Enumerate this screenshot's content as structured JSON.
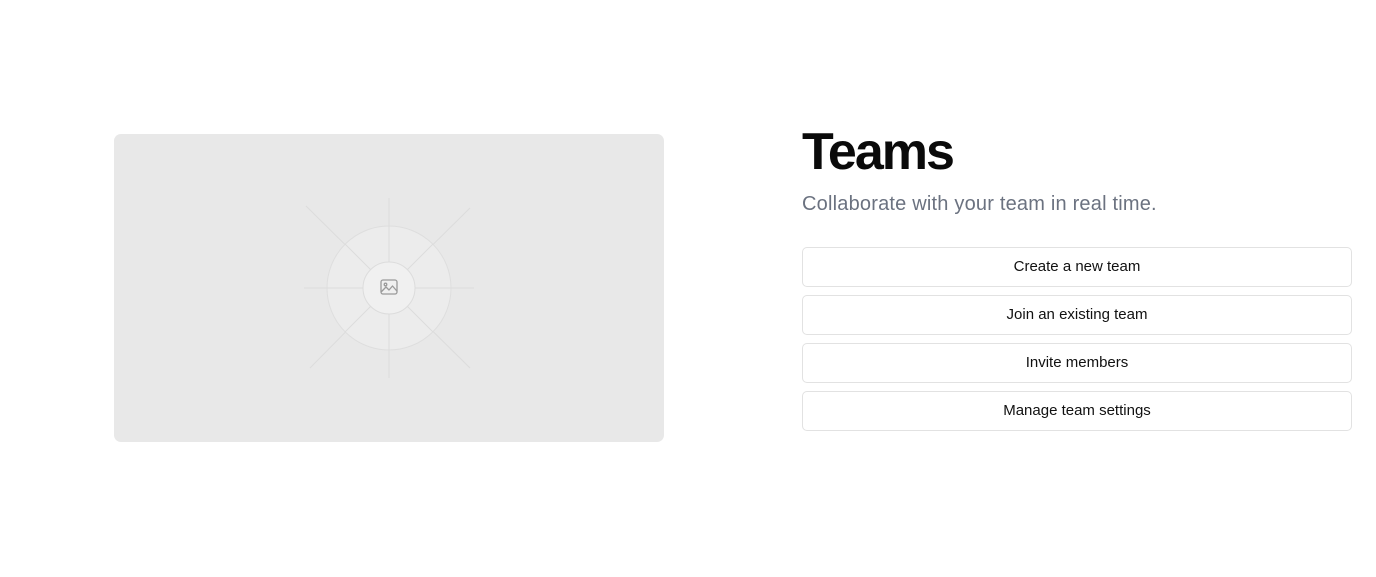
{
  "hero": {
    "image_icon": "image-icon"
  },
  "teams": {
    "title": "Teams",
    "subtitle": "Collaborate with your team in real time.",
    "actions": [
      {
        "label": "Create a new team"
      },
      {
        "label": "Join an existing team"
      },
      {
        "label": "Invite members"
      },
      {
        "label": "Manage team settings"
      }
    ]
  },
  "colors": {
    "placeholder_background": "#e8e8e8",
    "title_text": "#0a0a0a",
    "subtitle_text": "#6b7280",
    "button_border": "#e2e2e2"
  }
}
